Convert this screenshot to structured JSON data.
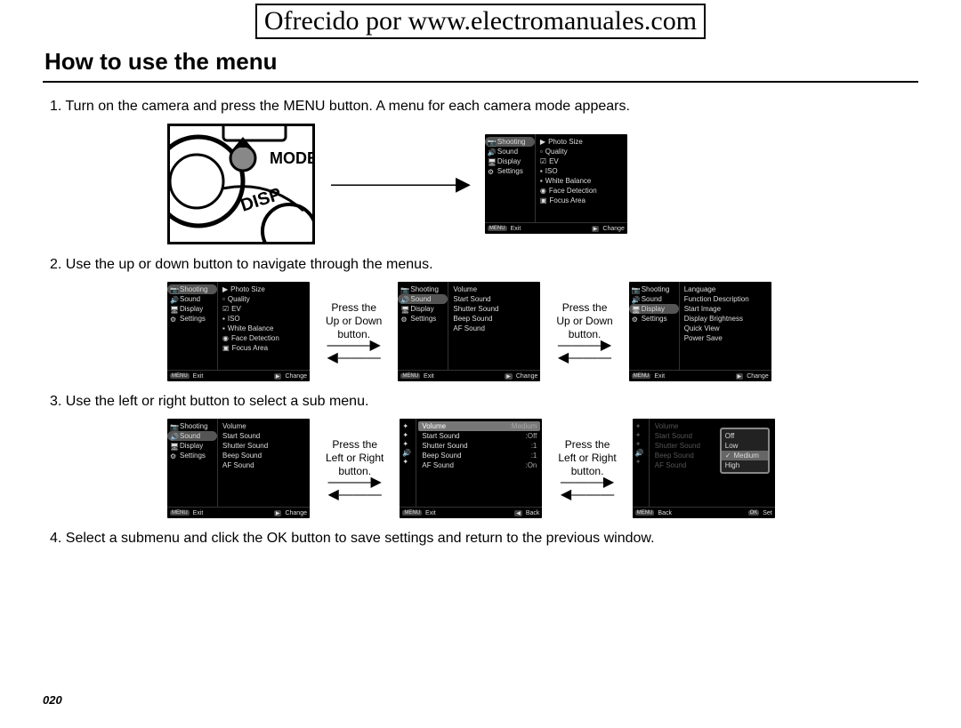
{
  "watermark": "Ofrecido por www.electromanuales.com",
  "title": "How to use the menu",
  "steps": {
    "s1": "1. Turn on the camera and press the MENU button. A menu for each camera mode appears.",
    "s2": "2. Use the up or down button to navigate through the menus.",
    "s3": "3. Use the left or right button to select a sub menu.",
    "s4": "4. Select a submenu and click the OK button to save settings and return to the previous window."
  },
  "captions": {
    "updown": "Press the\nUp or Down\nbutton.",
    "leftright": "Press the\nLeft or Right\nbutton."
  },
  "camera_labels": {
    "mode": "MODE",
    "disp": "DISP"
  },
  "menu": {
    "left_items": [
      "Shooting",
      "Sound",
      "Display",
      "Settings"
    ],
    "shooting_items": [
      "Photo Size",
      "Quality",
      "EV",
      "ISO",
      "White Balance",
      "Face Detection",
      "Focus Area"
    ],
    "sound_items": [
      "Volume",
      "Start Sound",
      "Shutter Sound",
      "Beep Sound",
      "AF Sound"
    ],
    "display_items": [
      "Language",
      "Function Description",
      "Start Image",
      "Display Brightness",
      "Quick View",
      "Power Save"
    ],
    "sound_detail": {
      "rows": [
        {
          "k": "Volume",
          "v": ":Medium"
        },
        {
          "k": "Start Sound",
          "v": ":Off"
        },
        {
          "k": "Shutter Sound",
          "v": ":1"
        },
        {
          "k": "Beep Sound",
          "v": ":1"
        },
        {
          "k": "AF Sound",
          "v": ":On"
        }
      ]
    },
    "volume_options": [
      "Off",
      "Low",
      "Medium",
      "High"
    ]
  },
  "footer": {
    "menu": "MENU",
    "exit": "Exit",
    "play": "▶",
    "change": "Change",
    "back": "Back",
    "ok": "OK",
    "set": "Set",
    "left": "◀"
  },
  "page_number": "020"
}
